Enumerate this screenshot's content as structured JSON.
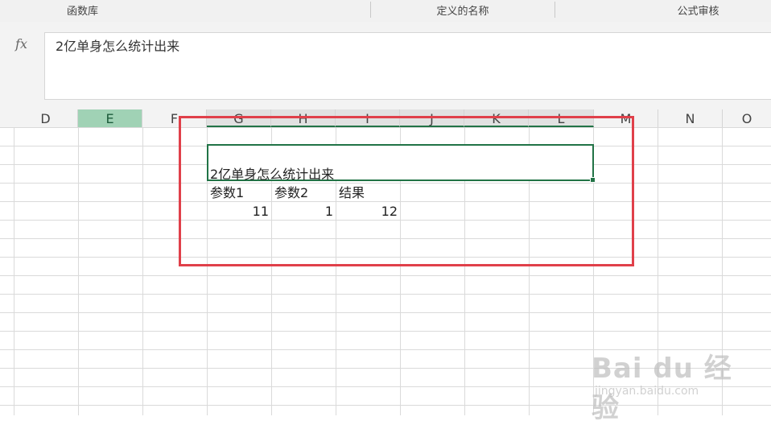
{
  "ribbon": {
    "groups": [
      "函数库",
      "定义的名称",
      "公式审核"
    ]
  },
  "formula_bar": {
    "fx_label": "fx",
    "value": "2亿单身怎么统计出来"
  },
  "columns": [
    "D",
    "E",
    "F",
    "G",
    "H",
    "I",
    "J",
    "K",
    "L",
    "M",
    "N",
    "O"
  ],
  "cells": {
    "title": "2亿单身怎么统计出来",
    "headers": [
      "参数1",
      "参数2",
      "结果"
    ],
    "values": [
      "11",
      "1",
      "12"
    ]
  },
  "watermark": {
    "brand": "Bai du 经验",
    "url": "jingyan.baidu.com"
  },
  "colors": {
    "accent": "#217346",
    "highlight": "#e0404a",
    "active_header": "#a0d2b5"
  }
}
